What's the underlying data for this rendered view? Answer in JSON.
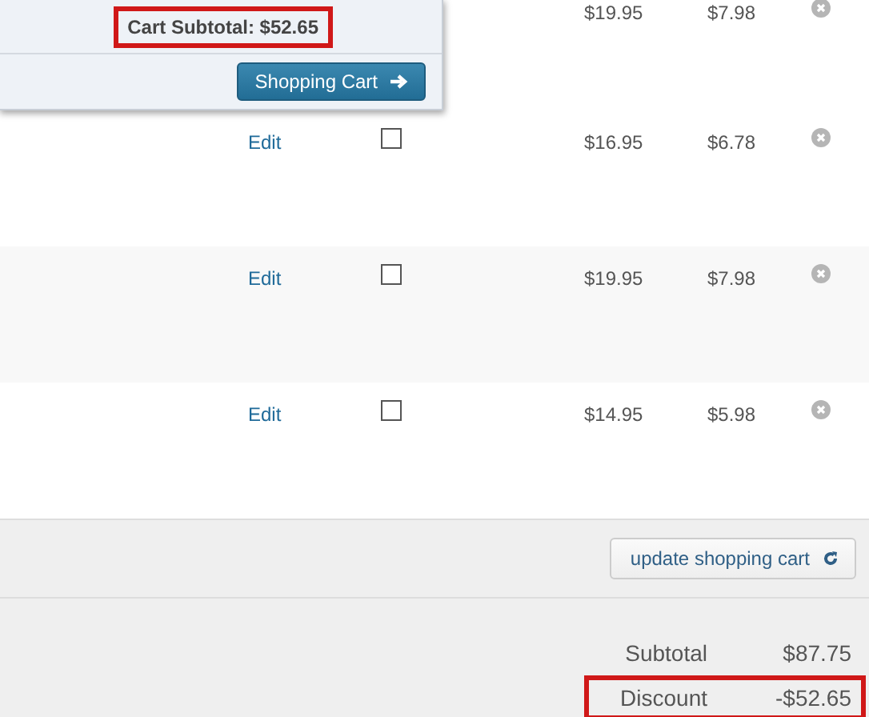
{
  "mini_cart": {
    "subtotal": "Cart Subtotal: $52.65",
    "subtotal_highlighted": true,
    "button": "Shopping Cart"
  },
  "rows": [
    {
      "edit": null,
      "checked": null,
      "price_1": "$19.95",
      "price_2": "$7.98"
    },
    {
      "edit": "Edit",
      "checked": false,
      "price_1": "$16.95",
      "price_2": "$6.78"
    },
    {
      "edit": "Edit",
      "checked": false,
      "price_1": "$19.95",
      "price_2": "$7.98"
    },
    {
      "edit": "Edit",
      "checked": false,
      "price_1": "$14.95",
      "price_2": "$5.98"
    }
  ],
  "update_button": "update shopping cart",
  "totals": [
    {
      "label": "Subtotal",
      "value": "$87.75",
      "highlighted": false
    },
    {
      "label": "Discount",
      "value": "-$52.65",
      "highlighted": true
    }
  ]
}
